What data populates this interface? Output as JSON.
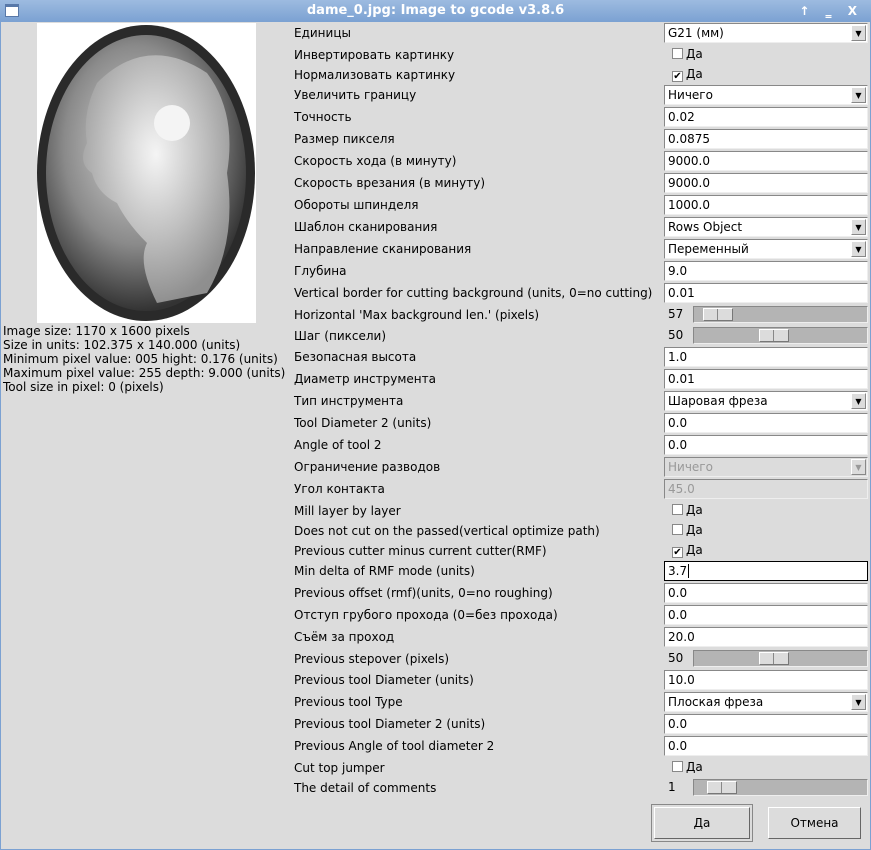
{
  "window": {
    "title": "dame_0.jpg: Image to gcode v3.8.6",
    "controls": "↑ ‗ X"
  },
  "info": [
    "Image size: 1170 x 1600 pixels",
    "Size in units: 102.375 x 140.000 (units)",
    "Minimum pixel value: 005 hight: 0.176 (units)",
    "Maximum pixel value: 255 depth: 9.000 (units)",
    "Tool size in pixel: 0 (pixels)"
  ],
  "rows": [
    {
      "type": "select",
      "label": "Единицы",
      "value": "G21 (мм)"
    },
    {
      "type": "check",
      "label": "Инвертировать картинку",
      "text": "Да",
      "checked": false
    },
    {
      "type": "check",
      "label": "Нормализовать картинку",
      "text": "Да",
      "checked": true
    },
    {
      "type": "select",
      "label": "Увеличить границу",
      "value": "Ничего"
    },
    {
      "type": "input",
      "label": "Точность",
      "value": "0.02"
    },
    {
      "type": "input",
      "label": "Размер пикселя",
      "value": "0.0875"
    },
    {
      "type": "input",
      "label": "Скорость хода (в минуту)",
      "value": "9000.0"
    },
    {
      "type": "input",
      "label": "Скорость врезания (в минуту)",
      "value": "9000.0"
    },
    {
      "type": "input",
      "label": "Обороты шпинделя",
      "value": "1000.0"
    },
    {
      "type": "select",
      "label": "Шаблон сканирования",
      "value": "Rows Object"
    },
    {
      "type": "select",
      "label": "Направление сканирования",
      "value": "Переменный"
    },
    {
      "type": "input",
      "label": "Глубина",
      "value": "9.0"
    },
    {
      "type": "input",
      "label": "Vertical border for cutting background (units, 0=no cutting)",
      "value": "0.01"
    },
    {
      "type": "slider",
      "label": "Horizontal 'Max background len.' (pixels)",
      "value": "57",
      "level": 0.05
    },
    {
      "type": "slider",
      "label": "Шаг (пиксели)",
      "value": "50",
      "level": 0.45
    },
    {
      "type": "input",
      "label": "Безопасная высота",
      "value": "1.0"
    },
    {
      "type": "input",
      "label": "Диаметр инструмента",
      "value": "0.01"
    },
    {
      "type": "select",
      "label": "Тип инструмента",
      "value": "Шаровая фреза"
    },
    {
      "type": "input",
      "label": "Tool Diameter 2 (units)",
      "value": "0.0"
    },
    {
      "type": "input",
      "label": "Angle of tool 2",
      "value": "0.0"
    },
    {
      "type": "select",
      "label": "Ограничение разводов",
      "value": "Ничего",
      "disabled": true
    },
    {
      "type": "input",
      "label": "Угол контакта",
      "value": "45.0",
      "disabled": true
    },
    {
      "type": "check",
      "label": "Mill layer by layer",
      "text": "Да",
      "checked": false
    },
    {
      "type": "check",
      "label": "Does not cut on the passed(vertical optimize path)",
      "text": "Да",
      "checked": false
    },
    {
      "type": "check",
      "label": "Previous cutter minus current cutter(RMF)",
      "text": "Да",
      "checked": true
    },
    {
      "type": "input",
      "label": "Min delta of RMF mode (units)",
      "value": "3.7",
      "focused": true
    },
    {
      "type": "input",
      "label": "Previous offset (rmf)(units, 0=no roughing)",
      "value": "0.0"
    },
    {
      "type": "input",
      "label": "Отступ грубого прохода (0=без прохода)",
      "value": "0.0"
    },
    {
      "type": "input",
      "label": "Съём за проход",
      "value": "20.0"
    },
    {
      "type": "slider",
      "label": "Previous stepover (pixels)",
      "value": "50",
      "level": 0.45
    },
    {
      "type": "input",
      "label": "Previous tool Diameter (units)",
      "value": "10.0"
    },
    {
      "type": "select",
      "label": "Previous tool Type",
      "value": "Плоская фреза"
    },
    {
      "type": "input",
      "label": "Previous tool Diameter 2 (units)",
      "value": "0.0"
    },
    {
      "type": "input",
      "label": "Previous Angle of tool diameter 2",
      "value": "0.0"
    },
    {
      "type": "check",
      "label": "Cut top jumper",
      "text": "Да",
      "checked": false
    },
    {
      "type": "slider",
      "label": "The detail of comments",
      "value": "1",
      "level": 0.08
    }
  ],
  "buttons": {
    "ok": "Да",
    "cancel": "Отмена"
  }
}
